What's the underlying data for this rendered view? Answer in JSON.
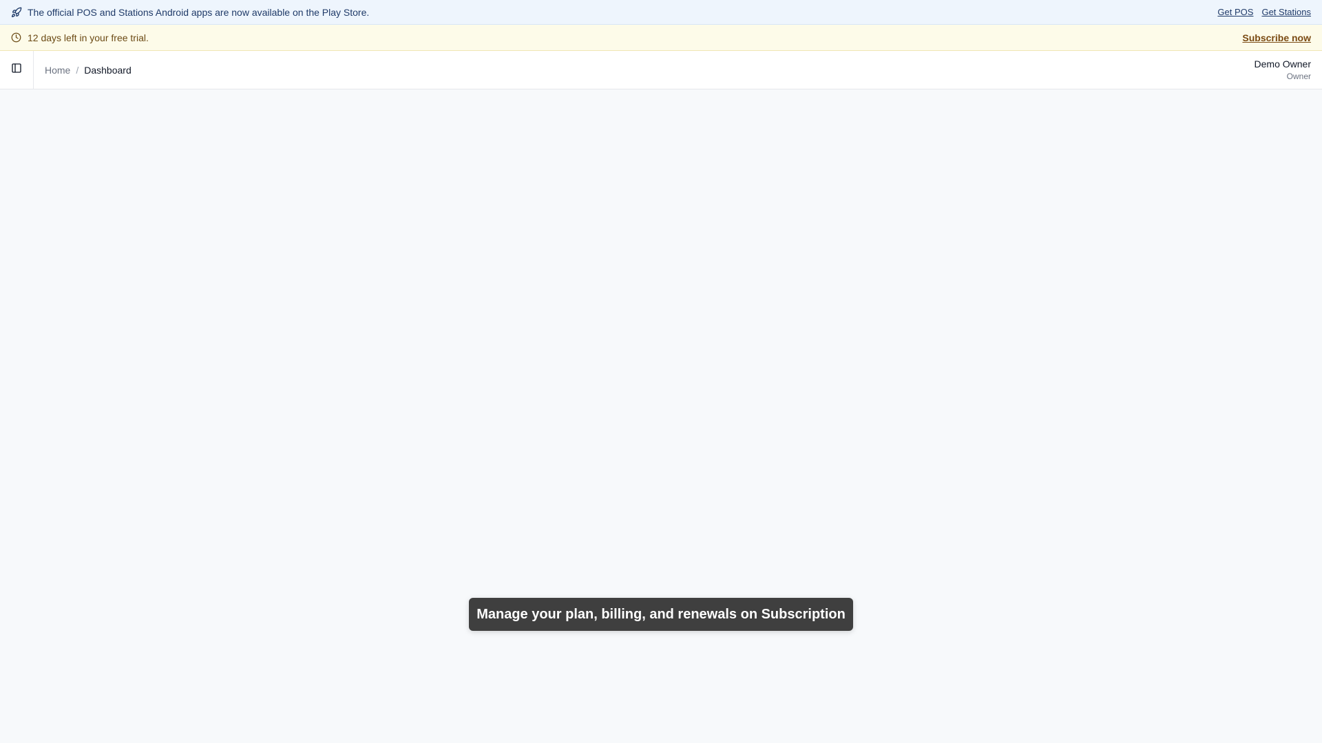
{
  "announcement": {
    "icon": "rocket-icon",
    "message": "The official POS and Stations Android apps are now available on the Play Store.",
    "links": [
      "Get POS",
      "Get Stations"
    ]
  },
  "trial": {
    "icon": "clock-icon",
    "message": "12 days left in your free trial.",
    "cta": "Subscribe now"
  },
  "header": {
    "toggle_icon": "sidebar-toggle-icon",
    "breadcrumb": [
      "Home",
      "Dashboard"
    ],
    "separator": "/",
    "user": {
      "name": "Demo Owner",
      "role": "Owner"
    }
  },
  "toast": {
    "message": "Manage your plan, billing, and renewals on Subscription"
  }
}
